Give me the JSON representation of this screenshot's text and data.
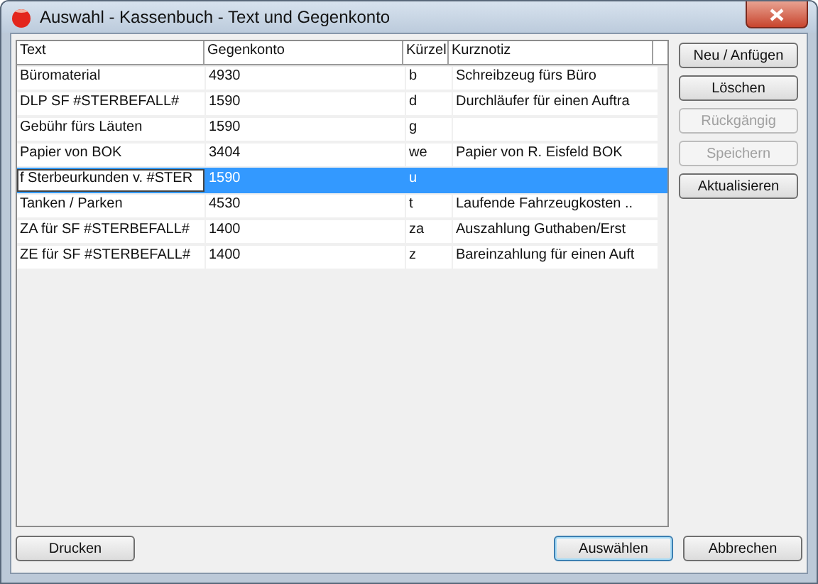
{
  "window": {
    "title": "Auswahl - Kassenbuch - Text und Gegenkonto"
  },
  "table": {
    "columns": [
      "Text",
      "Gegenkonto",
      "Kürzel",
      "Kurznotiz"
    ],
    "rows": [
      {
        "cells": [
          "Büromaterial",
          "4930",
          "b",
          "Schreibzeug fürs Büro"
        ],
        "selected": false
      },
      {
        "cells": [
          "DLP SF #STERBEFALL#",
          "1590",
          "d",
          "Durchläufer für einen Auftra"
        ],
        "selected": false
      },
      {
        "cells": [
          "Gebühr fürs Läuten",
          "1590",
          "g",
          ""
        ],
        "selected": false
      },
      {
        "cells": [
          "Papier von BOK",
          "3404",
          "we",
          "Papier von R. Eisfeld BOK"
        ],
        "selected": false
      },
      {
        "cells": [
          "f Sterbeurkunden v. #STER",
          "1590",
          "u",
          ""
        ],
        "selected": true
      },
      {
        "cells": [
          "Tanken / Parken",
          "4530",
          "t",
          "Laufende Fahrzeugkosten .."
        ],
        "selected": false
      },
      {
        "cells": [
          "ZA für SF #STERBEFALL#",
          "1400",
          "za",
          "Auszahlung Guthaben/Erst"
        ],
        "selected": false
      },
      {
        "cells": [
          "ZE für SF #STERBEFALL#",
          "1400",
          "z",
          "Bareinzahlung für einen Auft"
        ],
        "selected": false
      }
    ]
  },
  "side_buttons": [
    {
      "label": "Neu / Anfügen",
      "disabled": false
    },
    {
      "label": "Löschen",
      "disabled": false
    },
    {
      "label": "Rückgängig",
      "disabled": true
    },
    {
      "label": "Speichern",
      "disabled": true
    },
    {
      "label": "Aktualisieren",
      "disabled": false
    }
  ],
  "bottom_buttons": [
    {
      "label": "Drucken",
      "default": false
    },
    {
      "label": "Auswählen",
      "default": true
    },
    {
      "label": "Abbrechen",
      "default": false
    }
  ]
}
